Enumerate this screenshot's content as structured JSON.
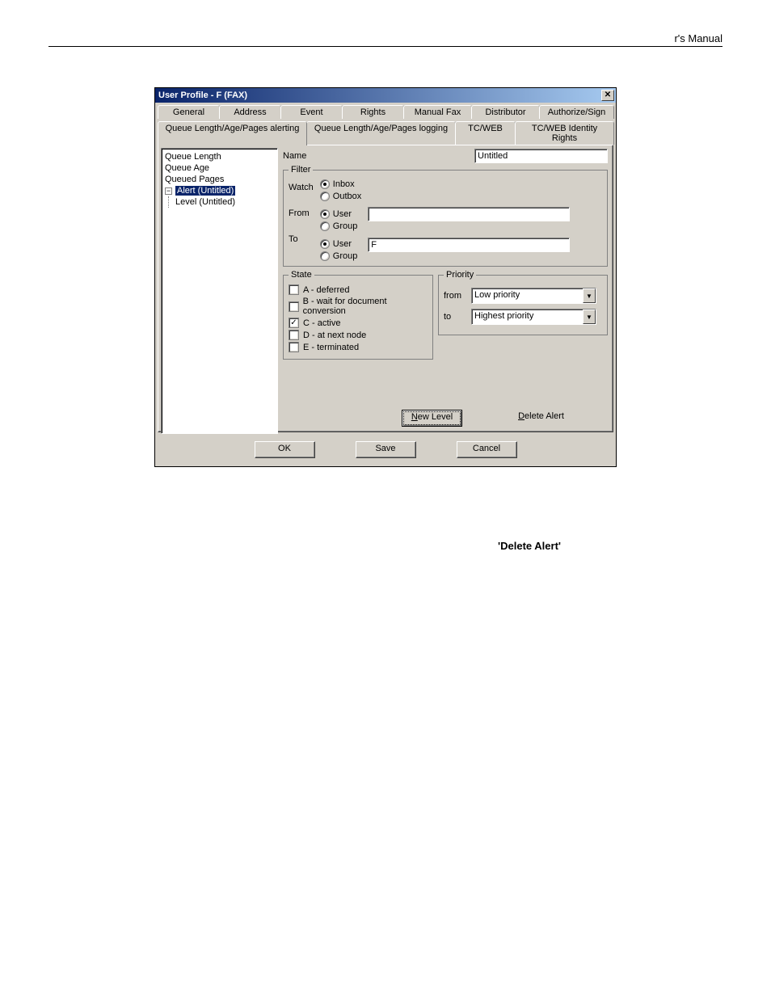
{
  "page": {
    "header_text": "r's Manual"
  },
  "dialog": {
    "title": "User Profile - F (FAX)",
    "close_icon": "✕",
    "tabs_row1": [
      "General",
      "Address",
      "Event",
      "Rights",
      "Manual Fax",
      "Distributor",
      "Authorize/Sign"
    ],
    "tabs_row2": [
      "Queue Length/Age/Pages alerting",
      "Queue Length/Age/Pages logging",
      "TC/WEB",
      "TC/WEB Identity Rights"
    ],
    "active_tab": "Queue Length/Age/Pages alerting",
    "tree": {
      "items": [
        "Queue Length",
        "Queue Age",
        "Queued Pages"
      ],
      "alert_label": "Alert (Untitled)",
      "level_label": "Level (Untitled)",
      "toggle": "−"
    },
    "name": {
      "label": "Name",
      "value": "Untitled"
    },
    "filter": {
      "legend": "Filter",
      "watch_label": "Watch",
      "from_label": "From",
      "to_label": "To",
      "watch_opts": [
        "Inbox",
        "Outbox"
      ],
      "from_opts": [
        "User",
        "Group"
      ],
      "to_opts": [
        "User",
        "Group"
      ],
      "from_value": "",
      "to_value": "F"
    },
    "state": {
      "legend": "State",
      "items": [
        {
          "label": "A - deferred",
          "checked": false
        },
        {
          "label": "B - wait for document conversion",
          "checked": false
        },
        {
          "label": "C - active",
          "checked": true
        },
        {
          "label": "D - at next node",
          "checked": false
        },
        {
          "label": "E - terminated",
          "checked": false
        }
      ]
    },
    "priority": {
      "legend": "Priority",
      "from_label": "from",
      "to_label": "to",
      "from_value": "Low priority",
      "to_value": "Highest priority"
    },
    "inner_buttons": {
      "new_level": "New Level",
      "delete_alert": "Delete Alert"
    },
    "footer_buttons": {
      "ok": "OK",
      "save": "Save",
      "cancel": "Cancel"
    }
  },
  "body_text": {
    "line": "'Delete Alert'"
  }
}
